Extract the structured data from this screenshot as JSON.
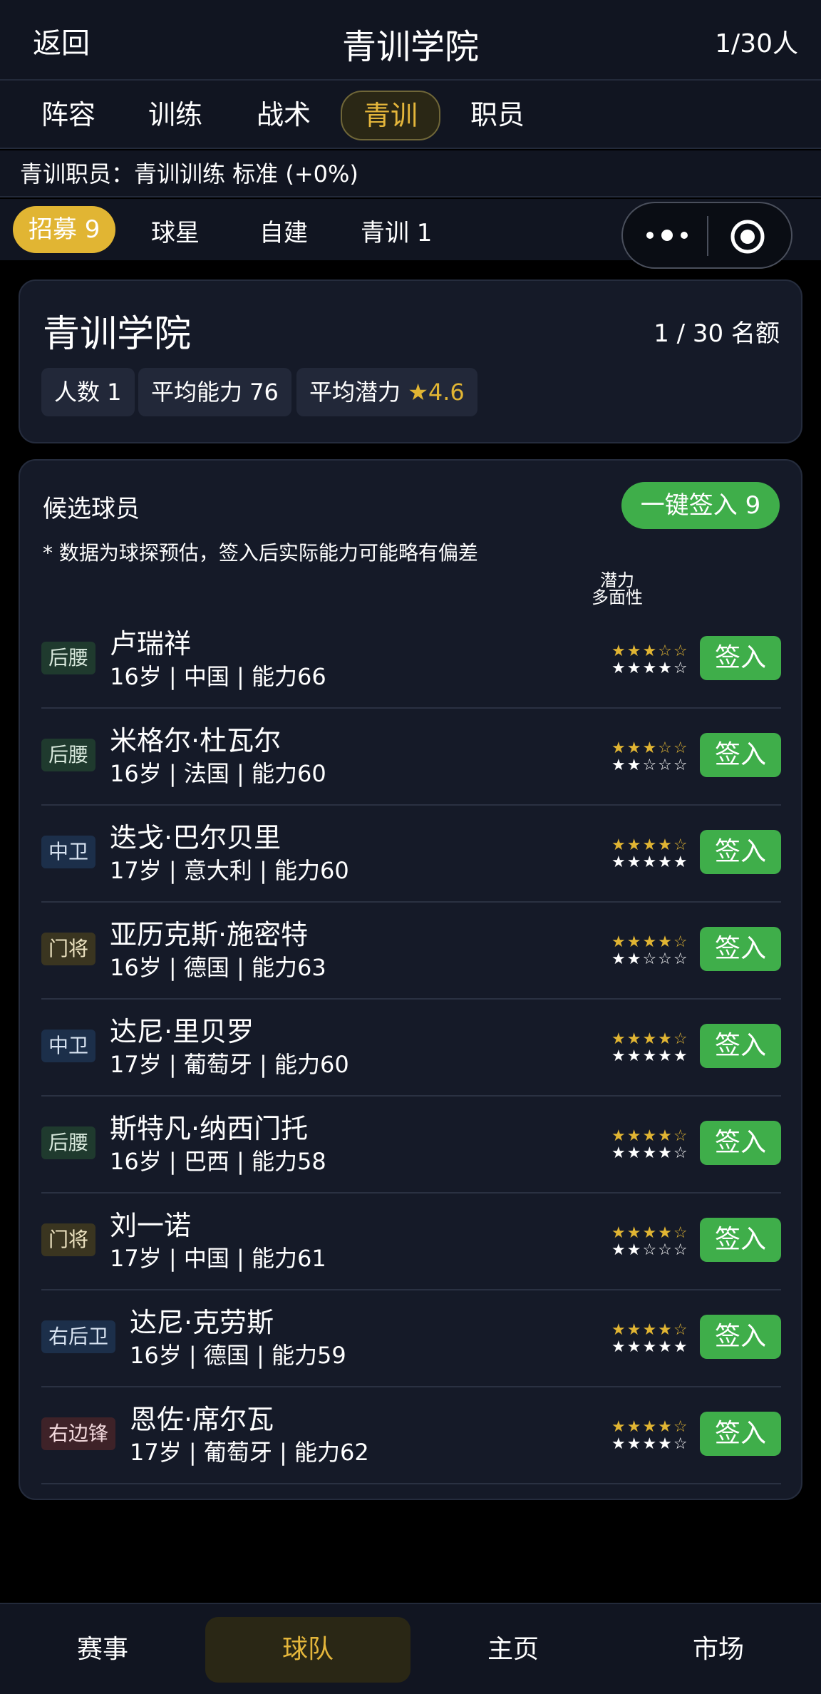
{
  "header": {
    "back": "返回",
    "title": "青训学院",
    "count": "1/30人"
  },
  "tabs": [
    "阵容",
    "训练",
    "战术",
    "青训",
    "职员"
  ],
  "staff_line": "青训职员：青训训练 标准 (+0%)",
  "subtabs": [
    "招募 9",
    "球星",
    "自建",
    "青训 1"
  ],
  "academy": {
    "title": "青训学院",
    "quota": "1 / 30 名额",
    "chips": {
      "headcount": "人数 1",
      "avg_ability": "平均能力 76",
      "avg_potential_label": "平均潜力",
      "avg_potential_value": "★4.6"
    }
  },
  "candidates": {
    "title": "候选球员",
    "sign_all": "一键签入 9",
    "note": "* 数据为球探预估，签入后实际能力可能略有偏差",
    "col_potential": "潜力",
    "col_versatility": "多面性",
    "sign_label": "签入",
    "players": [
      {
        "pos": "后腰",
        "name": "卢瑞祥",
        "info": "16岁 | 中国 | 能力66",
        "potential": 3,
        "versatility": 4
      },
      {
        "pos": "后腰",
        "name": "米格尔·杜瓦尔",
        "info": "16岁 | 法国 | 能力60",
        "potential": 3,
        "versatility": 2
      },
      {
        "pos": "中卫",
        "name": "迭戈·巴尔贝里",
        "info": "17岁 | 意大利 | 能力60",
        "potential": 4,
        "versatility": 5
      },
      {
        "pos": "门将",
        "name": "亚历克斯·施密特",
        "info": "16岁 | 德国 | 能力63",
        "potential": 4,
        "versatility": 2
      },
      {
        "pos": "中卫",
        "name": "达尼·里贝罗",
        "info": "17岁 | 葡萄牙 | 能力60",
        "potential": 4,
        "versatility": 5
      },
      {
        "pos": "后腰",
        "name": "斯特凡·纳西门托",
        "info": "16岁 | 巴西 | 能力58",
        "potential": 4,
        "versatility": 4
      },
      {
        "pos": "门将",
        "name": "刘一诺",
        "info": "17岁 | 中国 | 能力61",
        "potential": 4,
        "versatility": 2
      },
      {
        "pos": "右后卫",
        "name": "达尼·克劳斯",
        "info": "16岁 | 德国 | 能力59",
        "potential": 4,
        "versatility": 5
      },
      {
        "pos": "右边锋",
        "name": "恩佐·席尔瓦",
        "info": "17岁 | 葡萄牙 | 能力62",
        "potential": 4,
        "versatility": 4
      }
    ]
  },
  "bottom_nav": [
    "赛事",
    "球队",
    "主页",
    "市场"
  ],
  "colors": {
    "accent_gold": "#e1b533",
    "sign_green": "#3fae4a",
    "background": "#000000",
    "panel": "#151a28"
  }
}
